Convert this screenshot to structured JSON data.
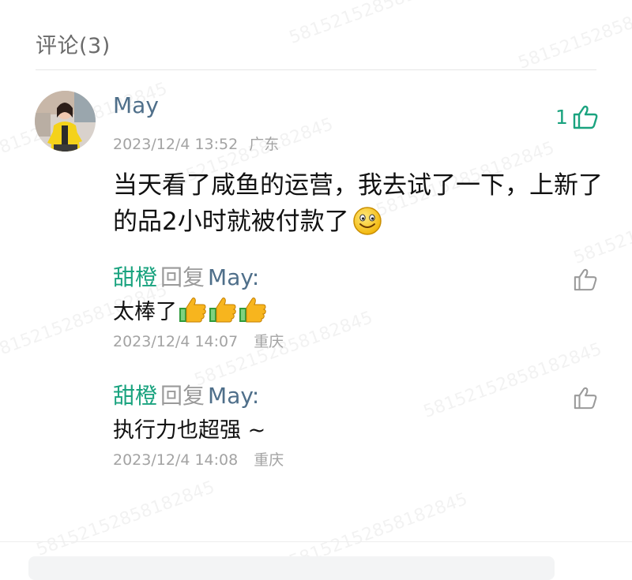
{
  "header": {
    "title": "评论(3)"
  },
  "comment": {
    "user": "May",
    "time": "2023/12/4 13:52",
    "location": "广东",
    "likes": "1",
    "text": "当天看了咸鱼的运营，我去试了一下，上新了的品2小时就被付款了"
  },
  "replies": [
    {
      "author": "甜橙",
      "verb": "回复",
      "target": "May",
      "colon": ":",
      "text": "太棒了",
      "time": "2023/12/4 14:07",
      "location": "重庆"
    },
    {
      "author": "甜橙",
      "verb": "回复",
      "target": "May",
      "colon": ":",
      "text": "执行力也超强 ~",
      "time": "2023/12/4 14:08",
      "location": "重庆"
    }
  ],
  "watermark": "58152152858182845"
}
